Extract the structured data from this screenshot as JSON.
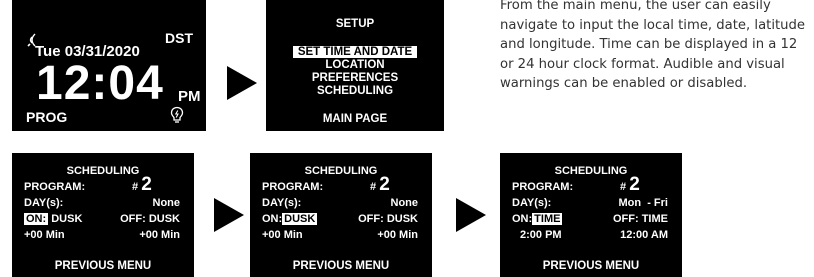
{
  "clock_screen": {
    "signal_icon": "radio-signal-icon",
    "dst": "DST",
    "date": "Tue 03/31/2020",
    "time": "12:04",
    "ampm": "PM",
    "prog": "PROG",
    "bulb_icon": "light-bulb-icon"
  },
  "setup_screen": {
    "title": "SETUP",
    "items": [
      "SET TIME AND DATE",
      "LOCATION",
      "PREFERENCES",
      "SCHEDULING"
    ],
    "selected_item": "SET TIME AND DATE",
    "main_page": "MAIN PAGE"
  },
  "description": "From the main menu, the user can easily navigate to input the local time, date, latitude and longitude. Time can be displayed in a 12 or 24 hour clock format. Audible and visual warnings can be enabled or disabled.",
  "scheduling_screens": [
    {
      "title": "SCHEDULING",
      "program_label": "PROGRAM:",
      "program_hash": "#",
      "program_number": "2",
      "days_label": "DAY(s):",
      "days_value": "None",
      "on_label": "ON:",
      "on_value": "DUSK",
      "off_value": "OFF: DUSK",
      "on_offset": "+00 Min",
      "off_offset": "+00 Min",
      "previous_menu": "PREVIOUS MENU",
      "highlight": "on_label"
    },
    {
      "title": "SCHEDULING",
      "program_label": "PROGRAM:",
      "program_hash": "#",
      "program_number": "2",
      "days_label": "DAY(s):",
      "days_value": "None",
      "on_label": "ON:",
      "on_value": "DUSK",
      "off_value": "OFF: DUSK",
      "on_offset": "+00 Min",
      "off_offset": "+00 Min",
      "previous_menu": "PREVIOUS MENU",
      "highlight": "on_value"
    },
    {
      "title": "SCHEDULING",
      "program_label": "PROGRAM:",
      "program_hash": "#",
      "program_number": "2",
      "days_label": "DAY(s):",
      "days_value": "Mon  - Fri",
      "on_label": "ON:",
      "on_value": "TIME",
      "off_value": "OFF: TIME",
      "on_offset": "2:00 PM",
      "off_offset": "12:00 AM",
      "previous_menu": "PREVIOUS MENU",
      "highlight": "on_value"
    }
  ],
  "arrow_icon": "right-arrow-icon"
}
